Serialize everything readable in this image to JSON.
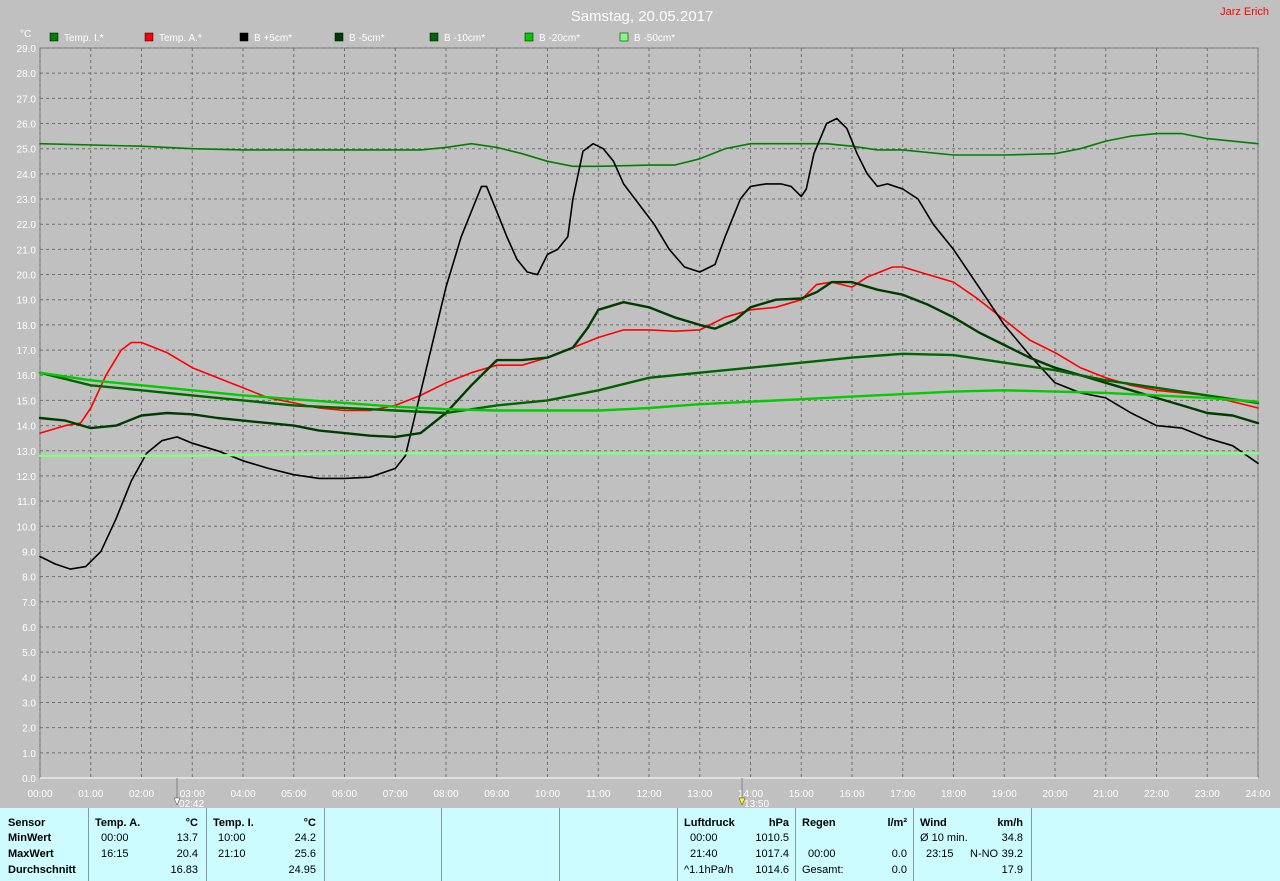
{
  "title": "Samstag, 20.05.2017",
  "author": "Jarz Erich",
  "y_unit": "°C",
  "colors": {
    "background": "#c0c0c0",
    "grid": "#6e6e6e",
    "text": "#ffffff",
    "author": "#ff0000",
    "table_bg": "#ccfcff"
  },
  "markers": [
    {
      "time": "02:42",
      "label": "02:42",
      "icon": "sunrise-marker-icon"
    },
    {
      "time": "13:50",
      "label": "13:50",
      "icon": "noon-marker-icon"
    }
  ],
  "chart_data": {
    "type": "line",
    "title": "Samstag, 20.05.2017",
    "ylabel": "°C",
    "xlabel": "",
    "ylim": [
      0,
      29
    ],
    "xlim": [
      "00:00",
      "24:00"
    ],
    "grid": true,
    "legend_position": "top",
    "y_ticks": [
      "0.0",
      "1.0",
      "2.0",
      "3.0",
      "4.0",
      "5.0",
      "6.0",
      "7.0",
      "8.0",
      "9.0",
      "10.0",
      "11.0",
      "12.0",
      "13.0",
      "14.0",
      "15.0",
      "16.0",
      "17.0",
      "18.0",
      "19.0",
      "20.0",
      "21.0",
      "22.0",
      "23.0",
      "24.0",
      "25.0",
      "26.0",
      "27.0",
      "28.0",
      "29.0"
    ],
    "x_ticks": [
      "00:00",
      "01:00",
      "02:00",
      "03:00",
      "04:00",
      "05:00",
      "06:00",
      "07:00",
      "08:00",
      "09:00",
      "10:00",
      "11:00",
      "12:00",
      "13:00",
      "14:00",
      "15:00",
      "16:00",
      "17:00",
      "18:00",
      "19:00",
      "20:00",
      "21:00",
      "22:00",
      "23:00",
      "24:00"
    ],
    "series": [
      {
        "name": "Temp. I.*",
        "color": "#008000",
        "width": 1.6,
        "points": [
          [
            0,
            25.2
          ],
          [
            2,
            25.1
          ],
          [
            3,
            25.0
          ],
          [
            4,
            24.95
          ],
          [
            6,
            24.95
          ],
          [
            7.5,
            24.95
          ],
          [
            8,
            25.05
          ],
          [
            8.5,
            25.2
          ],
          [
            9,
            25.05
          ],
          [
            9.5,
            24.8
          ],
          [
            10,
            24.5
          ],
          [
            10.5,
            24.3
          ],
          [
            11,
            24.3
          ],
          [
            12,
            24.35
          ],
          [
            12.5,
            24.35
          ],
          [
            13,
            24.6
          ],
          [
            13.5,
            25.0
          ],
          [
            14,
            25.2
          ],
          [
            15,
            25.2
          ],
          [
            15.5,
            25.2
          ],
          [
            16,
            25.1
          ],
          [
            16.5,
            24.95
          ],
          [
            17,
            24.95
          ],
          [
            18,
            24.75
          ],
          [
            19,
            24.75
          ],
          [
            20,
            24.8
          ],
          [
            20.5,
            25.0
          ],
          [
            21,
            25.3
          ],
          [
            21.5,
            25.5
          ],
          [
            22,
            25.6
          ],
          [
            22.5,
            25.6
          ],
          [
            23,
            25.4
          ],
          [
            24,
            25.2
          ]
        ]
      },
      {
        "name": "Temp. A.*",
        "color": "#ff0000",
        "width": 1.6,
        "points": [
          [
            0,
            13.7
          ],
          [
            0.5,
            14.0
          ],
          [
            0.8,
            14.1
          ],
          [
            1,
            14.7
          ],
          [
            1.3,
            16.0
          ],
          [
            1.6,
            17.0
          ],
          [
            1.8,
            17.3
          ],
          [
            2,
            17.3
          ],
          [
            2.5,
            16.9
          ],
          [
            3,
            16.3
          ],
          [
            3.5,
            15.9
          ],
          [
            4,
            15.5
          ],
          [
            4.5,
            15.1
          ],
          [
            5,
            14.9
          ],
          [
            5.5,
            14.7
          ],
          [
            6,
            14.6
          ],
          [
            6.5,
            14.6
          ],
          [
            7,
            14.8
          ],
          [
            7.5,
            15.2
          ],
          [
            8,
            15.7
          ],
          [
            8.5,
            16.1
          ],
          [
            9,
            16.4
          ],
          [
            9.5,
            16.4
          ],
          [
            10,
            16.7
          ],
          [
            10.5,
            17.1
          ],
          [
            11,
            17.5
          ],
          [
            11.5,
            17.8
          ],
          [
            12,
            17.8
          ],
          [
            12.5,
            17.75
          ],
          [
            13,
            17.8
          ],
          [
            13.5,
            18.3
          ],
          [
            14,
            18.6
          ],
          [
            14.5,
            18.7
          ],
          [
            15,
            19.0
          ],
          [
            15.3,
            19.6
          ],
          [
            15.6,
            19.7
          ],
          [
            16,
            19.5
          ],
          [
            16.3,
            19.9
          ],
          [
            16.8,
            20.3
          ],
          [
            17,
            20.3
          ],
          [
            17.5,
            20.0
          ],
          [
            18,
            19.7
          ],
          [
            18.5,
            19.0
          ],
          [
            19,
            18.2
          ],
          [
            19.5,
            17.4
          ],
          [
            20,
            16.9
          ],
          [
            20.5,
            16.3
          ],
          [
            21,
            15.9
          ],
          [
            21.5,
            15.6
          ],
          [
            22,
            15.4
          ],
          [
            22.5,
            15.3
          ],
          [
            23,
            15.2
          ],
          [
            24,
            14.7
          ]
        ]
      },
      {
        "name": "B +5cm*",
        "color": "#000000",
        "width": 1.6,
        "points": [
          [
            0,
            8.8
          ],
          [
            0.3,
            8.5
          ],
          [
            0.6,
            8.3
          ],
          [
            0.9,
            8.4
          ],
          [
            1.2,
            9.0
          ],
          [
            1.5,
            10.3
          ],
          [
            1.8,
            11.8
          ],
          [
            2.1,
            12.9
          ],
          [
            2.4,
            13.4
          ],
          [
            2.7,
            13.55
          ],
          [
            3,
            13.3
          ],
          [
            3.5,
            13.0
          ],
          [
            4,
            12.6
          ],
          [
            4.5,
            12.3
          ],
          [
            5,
            12.05
          ],
          [
            5.5,
            11.9
          ],
          [
            6,
            11.9
          ],
          [
            6.5,
            11.95
          ],
          [
            7,
            12.3
          ],
          [
            7.2,
            12.8
          ],
          [
            7.4,
            14.5
          ],
          [
            7.7,
            17.0
          ],
          [
            8,
            19.5
          ],
          [
            8.3,
            21.5
          ],
          [
            8.6,
            23.0
          ],
          [
            8.7,
            23.5
          ],
          [
            8.8,
            23.5
          ],
          [
            9,
            22.5
          ],
          [
            9.2,
            21.5
          ],
          [
            9.4,
            20.6
          ],
          [
            9.6,
            20.1
          ],
          [
            9.8,
            20.0
          ],
          [
            10,
            20.8
          ],
          [
            10.2,
            21.0
          ],
          [
            10.4,
            21.5
          ],
          [
            10.5,
            23.0
          ],
          [
            10.7,
            24.9
          ],
          [
            10.9,
            25.2
          ],
          [
            11.1,
            25.0
          ],
          [
            11.3,
            24.5
          ],
          [
            11.5,
            23.6
          ],
          [
            11.8,
            22.8
          ],
          [
            12.1,
            22.0
          ],
          [
            12.4,
            21.0
          ],
          [
            12.7,
            20.3
          ],
          [
            13,
            20.1
          ],
          [
            13.3,
            20.4
          ],
          [
            13.5,
            21.5
          ],
          [
            13.8,
            23.0
          ],
          [
            14,
            23.5
          ],
          [
            14.3,
            23.6
          ],
          [
            14.6,
            23.6
          ],
          [
            14.8,
            23.5
          ],
          [
            15,
            23.1
          ],
          [
            15.1,
            23.4
          ],
          [
            15.25,
            24.8
          ],
          [
            15.5,
            26.0
          ],
          [
            15.7,
            26.2
          ],
          [
            15.9,
            25.8
          ],
          [
            16.1,
            24.8
          ],
          [
            16.3,
            24.0
          ],
          [
            16.5,
            23.5
          ],
          [
            16.7,
            23.6
          ],
          [
            17,
            23.4
          ],
          [
            17.3,
            23.0
          ],
          [
            17.6,
            22.0
          ],
          [
            18,
            21.0
          ],
          [
            18.5,
            19.5
          ],
          [
            19,
            18.0
          ],
          [
            19.5,
            16.8
          ],
          [
            20,
            15.7
          ],
          [
            20.5,
            15.3
          ],
          [
            21,
            15.1
          ],
          [
            21.5,
            14.5
          ],
          [
            22,
            14.0
          ],
          [
            22.5,
            13.9
          ],
          [
            23,
            13.5
          ],
          [
            23.5,
            13.2
          ],
          [
            24,
            12.5
          ]
        ]
      },
      {
        "name": "B -5cm*",
        "color": "#003c00",
        "width": 2.4,
        "points": [
          [
            0,
            14.3
          ],
          [
            0.5,
            14.2
          ],
          [
            1,
            13.9
          ],
          [
            1.5,
            14.0
          ],
          [
            2,
            14.4
          ],
          [
            2.5,
            14.5
          ],
          [
            3,
            14.45
          ],
          [
            3.5,
            14.3
          ],
          [
            4,
            14.2
          ],
          [
            4.5,
            14.1
          ],
          [
            5,
            14.0
          ],
          [
            5.5,
            13.8
          ],
          [
            6,
            13.7
          ],
          [
            6.5,
            13.6
          ],
          [
            7,
            13.55
          ],
          [
            7.5,
            13.7
          ],
          [
            8,
            14.5
          ],
          [
            8.5,
            15.6
          ],
          [
            9,
            16.6
          ],
          [
            9.5,
            16.6
          ],
          [
            10,
            16.7
          ],
          [
            10.5,
            17.1
          ],
          [
            10.8,
            17.9
          ],
          [
            11,
            18.6
          ],
          [
            11.5,
            18.9
          ],
          [
            12,
            18.7
          ],
          [
            12.5,
            18.3
          ],
          [
            13,
            18.0
          ],
          [
            13.3,
            17.85
          ],
          [
            13.7,
            18.2
          ],
          [
            14,
            18.7
          ],
          [
            14.5,
            19.0
          ],
          [
            15,
            19.05
          ],
          [
            15.3,
            19.3
          ],
          [
            15.6,
            19.7
          ],
          [
            16,
            19.7
          ],
          [
            16.5,
            19.4
          ],
          [
            17,
            19.2
          ],
          [
            17.5,
            18.8
          ],
          [
            18,
            18.3
          ],
          [
            18.5,
            17.7
          ],
          [
            19,
            17.2
          ],
          [
            19.5,
            16.7
          ],
          [
            20,
            16.3
          ],
          [
            20.5,
            16.0
          ],
          [
            21,
            15.7
          ],
          [
            21.5,
            15.4
          ],
          [
            22,
            15.1
          ],
          [
            22.5,
            14.8
          ],
          [
            23,
            14.5
          ],
          [
            23.5,
            14.4
          ],
          [
            24,
            14.1
          ]
        ]
      },
      {
        "name": "B -10cm*",
        "color": "#006400",
        "width": 2.4,
        "points": [
          [
            0,
            16.1
          ],
          [
            1,
            15.6
          ],
          [
            2,
            15.4
          ],
          [
            3,
            15.2
          ],
          [
            4,
            15.0
          ],
          [
            5,
            14.8
          ],
          [
            6,
            14.7
          ],
          [
            7,
            14.6
          ],
          [
            8,
            14.5
          ],
          [
            9,
            14.8
          ],
          [
            10,
            15.0
          ],
          [
            11,
            15.4
          ],
          [
            12,
            15.9
          ],
          [
            13,
            16.1
          ],
          [
            14,
            16.3
          ],
          [
            15,
            16.5
          ],
          [
            16,
            16.7
          ],
          [
            17,
            16.85
          ],
          [
            18,
            16.8
          ],
          [
            19,
            16.5
          ],
          [
            20,
            16.2
          ],
          [
            21,
            15.8
          ],
          [
            22,
            15.5
          ],
          [
            23,
            15.2
          ],
          [
            24,
            14.9
          ]
        ]
      },
      {
        "name": "B -20cm*",
        "color": "#00cc00",
        "width": 2.4,
        "points": [
          [
            0,
            16.1
          ],
          [
            1,
            15.8
          ],
          [
            2,
            15.6
          ],
          [
            3,
            15.4
          ],
          [
            4,
            15.2
          ],
          [
            5,
            15.05
          ],
          [
            6,
            14.9
          ],
          [
            7,
            14.75
          ],
          [
            8,
            14.65
          ],
          [
            9,
            14.6
          ],
          [
            10,
            14.6
          ],
          [
            11,
            14.6
          ],
          [
            12,
            14.7
          ],
          [
            13,
            14.85
          ],
          [
            14,
            14.95
          ],
          [
            15,
            15.05
          ],
          [
            16,
            15.15
          ],
          [
            17,
            15.25
          ],
          [
            18,
            15.35
          ],
          [
            19,
            15.4
          ],
          [
            20,
            15.35
          ],
          [
            21,
            15.3
          ],
          [
            22,
            15.2
          ],
          [
            23,
            15.1
          ],
          [
            24,
            14.95
          ]
        ]
      },
      {
        "name": "B -50cm*",
        "color": "#80ff80",
        "width": 2.4,
        "points": [
          [
            0,
            12.8
          ],
          [
            3,
            12.8
          ],
          [
            6,
            12.9
          ],
          [
            9,
            12.9
          ],
          [
            12,
            12.9
          ],
          [
            15,
            12.9
          ],
          [
            18,
            12.9
          ],
          [
            21,
            12.9
          ],
          [
            24,
            12.9
          ]
        ]
      }
    ]
  },
  "table": {
    "sensor_col": {
      "header": "Sensor",
      "rows": [
        "MinWert",
        "MaxWert",
        "Durchschnitt"
      ]
    },
    "temp_a": {
      "header": "Temp. A.",
      "unit": "°C",
      "min_time": "00:00",
      "min": "13.7",
      "max_time": "16:15",
      "max": "20.4",
      "avg": "16.83"
    },
    "temp_i": {
      "header": "Temp. I.",
      "unit": "°C",
      "min_time": "10:00",
      "min": "24.2",
      "max_time": "21:10",
      "max": "25.6",
      "avg": "24.95"
    },
    "luftdruck": {
      "header": "Luftdruck",
      "unit": "hPa",
      "min_time": "00:00",
      "min": "1010.5",
      "max_time": "21:40",
      "max": "1017.4",
      "trend": "^1.1hPa/h",
      "avg": "1014.6"
    },
    "regen": {
      "header": "Regen",
      "unit": "l/m²",
      "time": "00:00",
      "value": "0.0",
      "total_label": "Gesamt:",
      "total": "0.0"
    },
    "wind": {
      "header": "Wind",
      "unit": "km/h",
      "avg_label": "Ø 10 min.",
      "avg": "34.8",
      "max_time": "23:15",
      "max_dir": "N-NO",
      "max": "39.2",
      "mean": "17.9"
    }
  }
}
